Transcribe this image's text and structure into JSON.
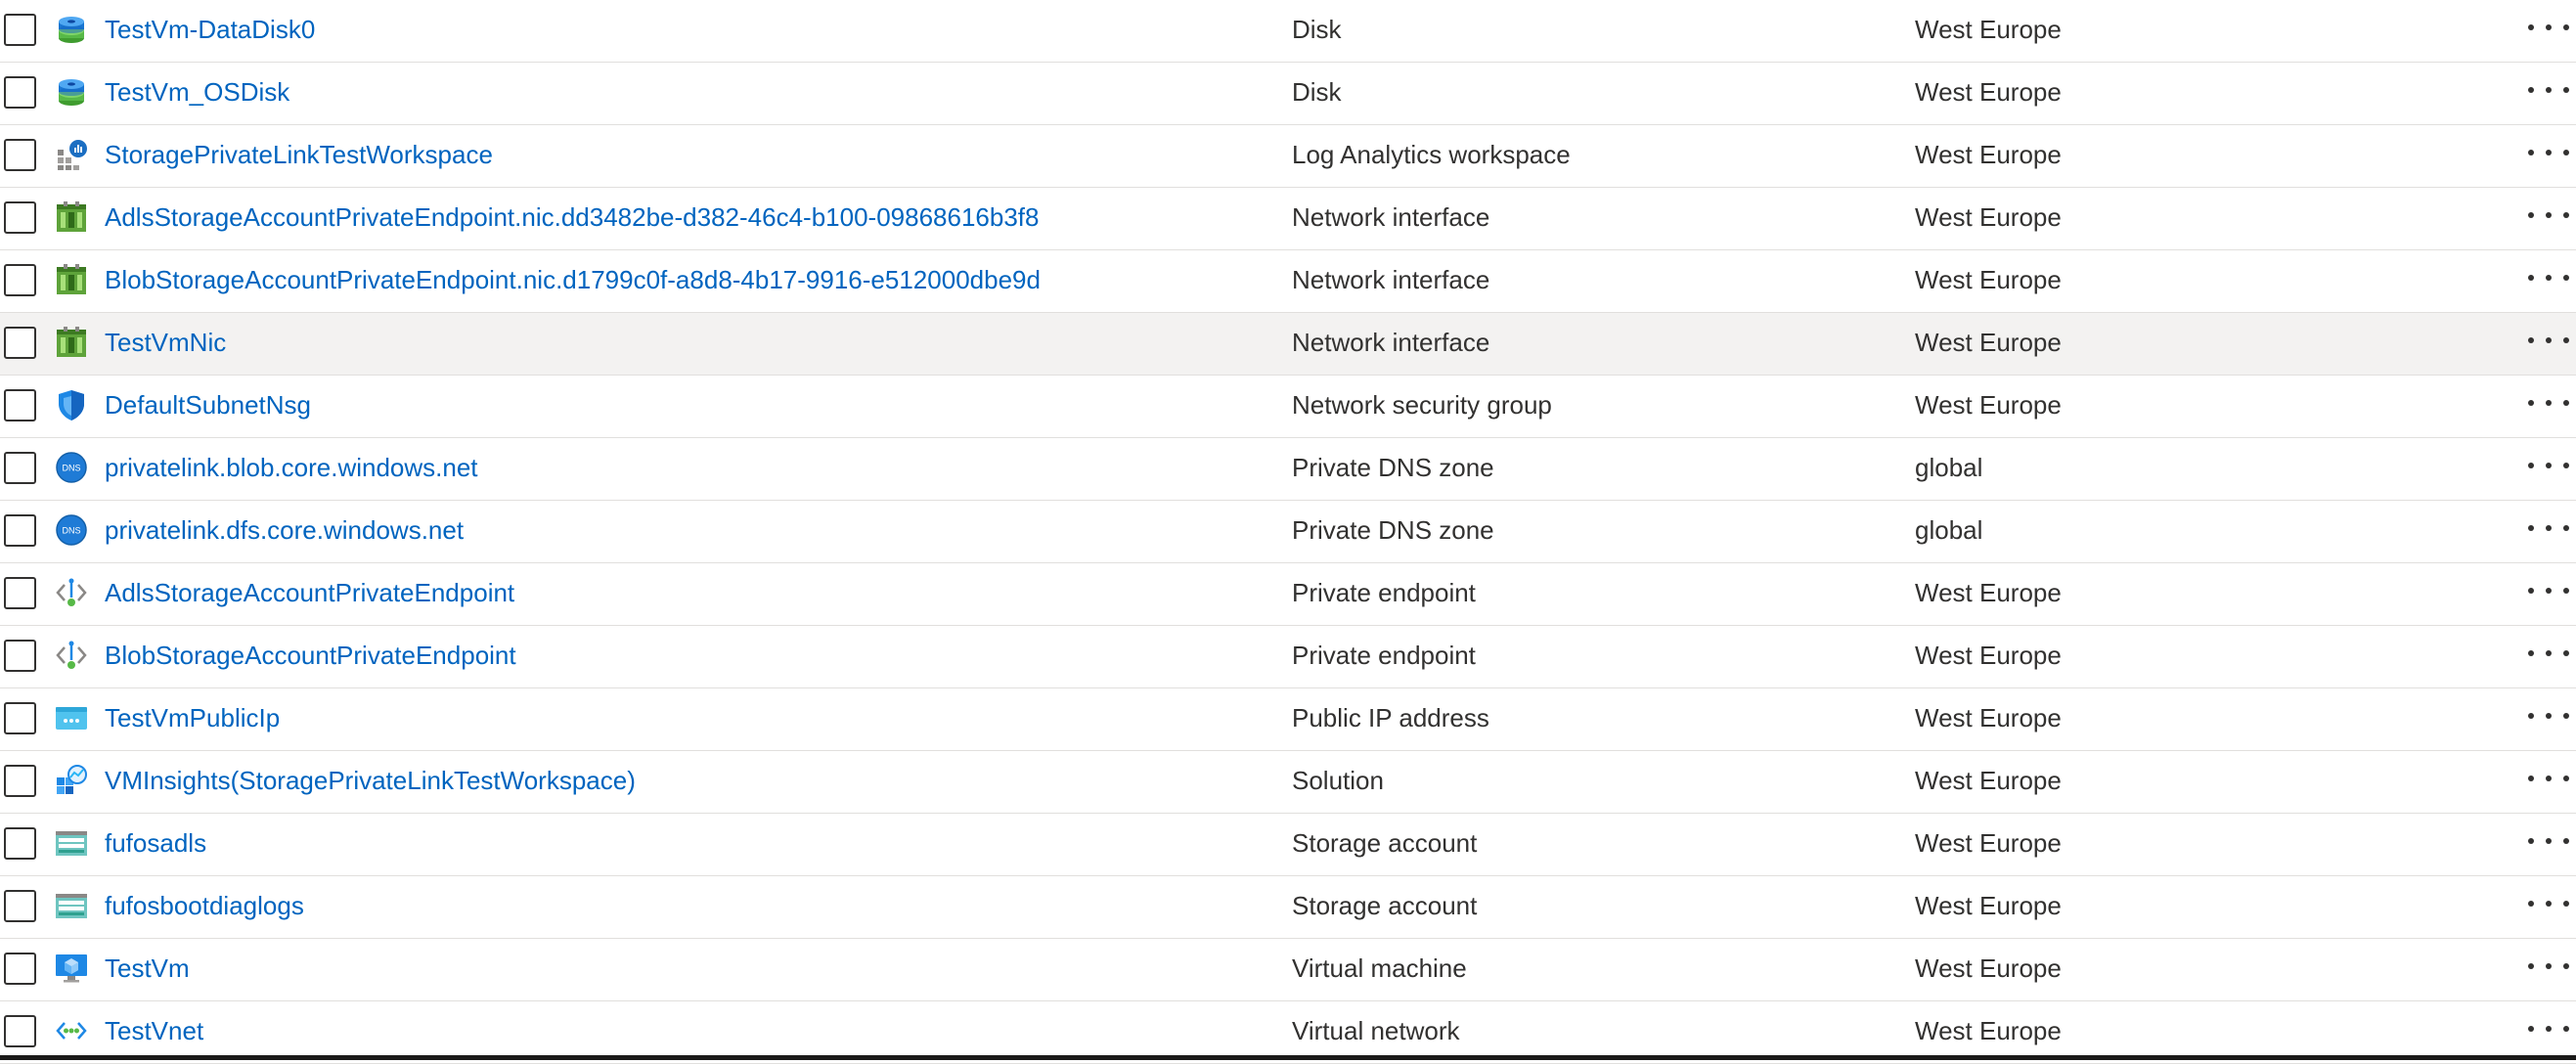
{
  "resources": [
    {
      "name": "TestVm-DataDisk0",
      "type": "Disk",
      "location": "West Europe",
      "icon": "disk-icon"
    },
    {
      "name": "TestVm_OSDisk",
      "type": "Disk",
      "location": "West Europe",
      "icon": "disk-icon"
    },
    {
      "name": "StoragePrivateLinkTestWorkspace",
      "type": "Log Analytics workspace",
      "location": "West Europe",
      "icon": "log-analytics-icon"
    },
    {
      "name": "AdlsStorageAccountPrivateEndpoint.nic.dd3482be-d382-46c4-b100-09868616b3f8",
      "type": "Network interface",
      "location": "West Europe",
      "icon": "network-interface-icon"
    },
    {
      "name": "BlobStorageAccountPrivateEndpoint.nic.d1799c0f-a8d8-4b17-9916-e512000dbe9d",
      "type": "Network interface",
      "location": "West Europe",
      "icon": "network-interface-icon"
    },
    {
      "name": "TestVmNic",
      "type": "Network interface",
      "location": "West Europe",
      "icon": "network-interface-icon",
      "highlighted": true
    },
    {
      "name": "DefaultSubnetNsg",
      "type": "Network security group",
      "location": "West Europe",
      "icon": "shield-icon"
    },
    {
      "name": "privatelink.blob.core.windows.net",
      "type": "Private DNS zone",
      "location": "global",
      "icon": "dns-icon",
      "icon_text": "DNS"
    },
    {
      "name": "privatelink.dfs.core.windows.net",
      "type": "Private DNS zone",
      "location": "global",
      "icon": "dns-icon",
      "icon_text": "DNS"
    },
    {
      "name": "AdlsStorageAccountPrivateEndpoint",
      "type": "Private endpoint",
      "location": "West Europe",
      "icon": "private-endpoint-icon"
    },
    {
      "name": "BlobStorageAccountPrivateEndpoint",
      "type": "Private endpoint",
      "location": "West Europe",
      "icon": "private-endpoint-icon"
    },
    {
      "name": "TestVmPublicIp",
      "type": "Public IP address",
      "location": "West Europe",
      "icon": "public-ip-icon"
    },
    {
      "name": "VMInsights(StoragePrivateLinkTestWorkspace)",
      "type": "Solution",
      "location": "West Europe",
      "icon": "solution-icon"
    },
    {
      "name": "fufosadls",
      "type": "Storage account",
      "location": "West Europe",
      "icon": "storage-account-icon"
    },
    {
      "name": "fufosbootdiaglogs",
      "type": "Storage account",
      "location": "West Europe",
      "icon": "storage-account-icon"
    },
    {
      "name": "TestVm",
      "type": "Virtual machine",
      "location": "West Europe",
      "icon": "virtual-machine-icon"
    },
    {
      "name": "TestVnet",
      "type": "Virtual network",
      "location": "West Europe",
      "icon": "virtual-network-icon"
    }
  ],
  "colors": {
    "link": "#0064bf",
    "text": "#323130",
    "row_border": "#e1dfdd",
    "row_highlight": "#f3f2f1"
  }
}
